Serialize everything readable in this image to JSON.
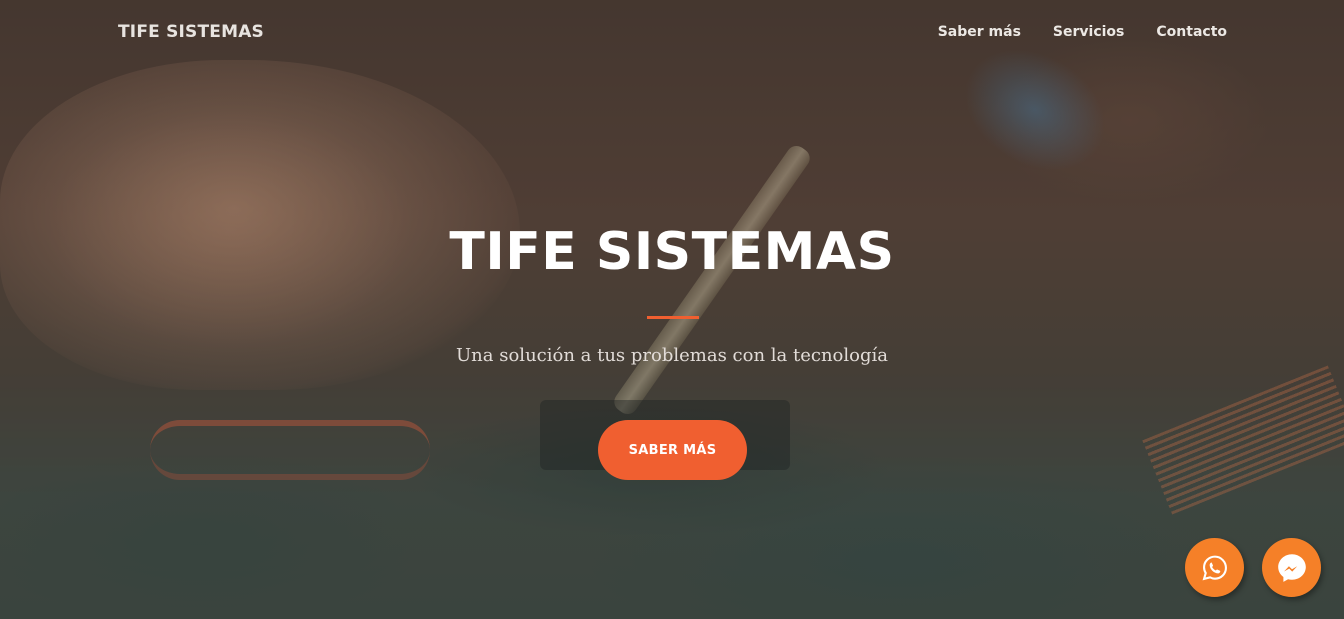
{
  "navbar": {
    "brand": "TIFE SISTEMAS",
    "links": [
      {
        "label": "Saber más"
      },
      {
        "label": "Servicios"
      },
      {
        "label": "Contacto"
      }
    ]
  },
  "hero": {
    "title": "TIFE SISTEMAS",
    "subtitle": "Una solución a tus problemas con la tecnología",
    "cta_label": "SABER MÁS"
  },
  "floating_buttons": [
    {
      "icon": "whatsapp-icon"
    },
    {
      "icon": "messenger-icon"
    }
  ],
  "colors": {
    "accent": "#f05f30",
    "floating": "#f58028"
  }
}
